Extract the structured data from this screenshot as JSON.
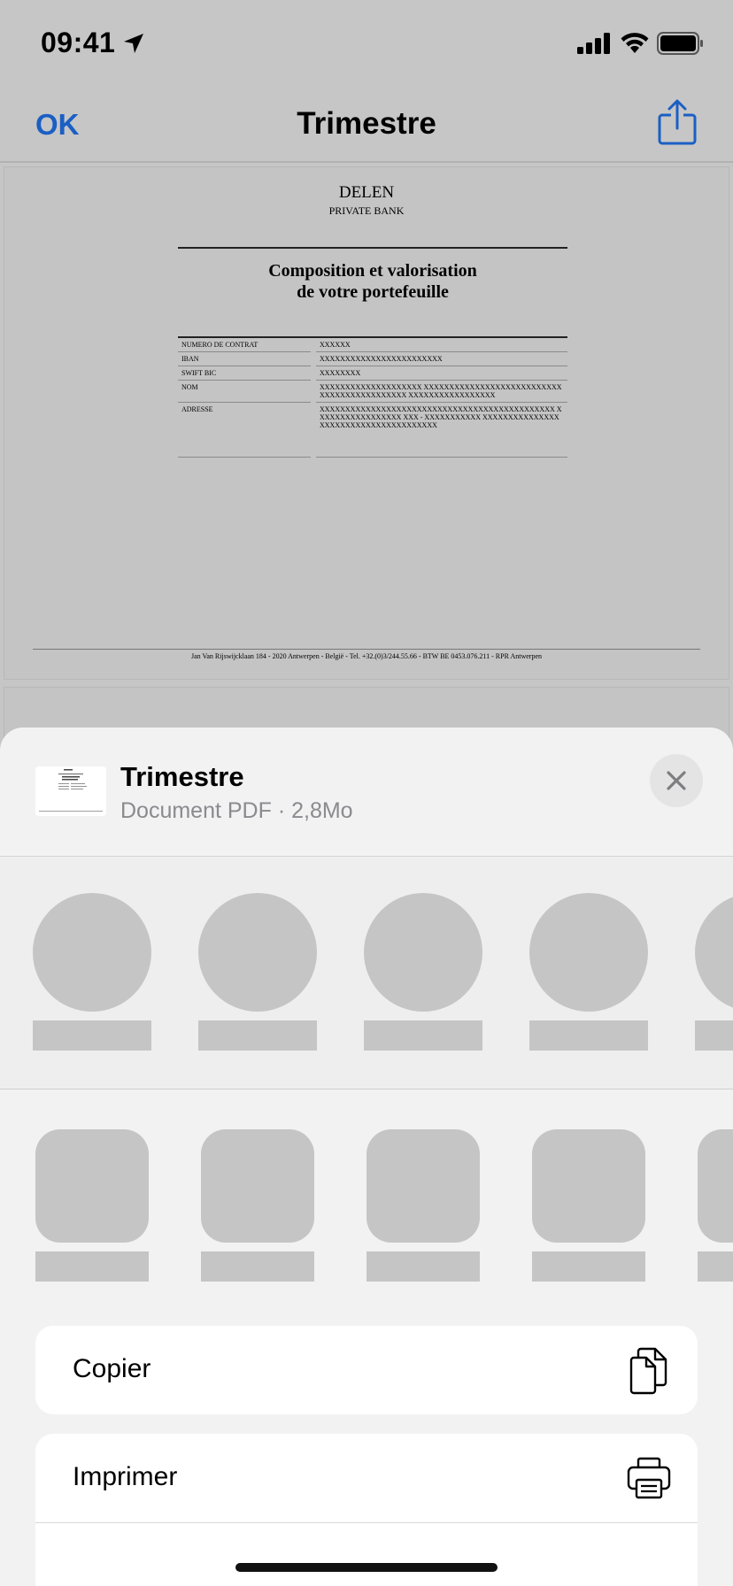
{
  "status_bar": {
    "time": "09:41"
  },
  "nav": {
    "ok_label": "OK",
    "title": "Trimestre"
  },
  "document": {
    "bank_name": "DELEN",
    "bank_subtitle": "PRIVATE BANK",
    "heading_line1": "Composition et valorisation",
    "heading_line2": "de votre portefeuille",
    "rows": [
      {
        "label": "NUMERO DE CONTRAT",
        "value": "XXXXXX"
      },
      {
        "label": "IBAN",
        "value": "XXXXXXXXXXXXXXXXXXXXXXXX"
      },
      {
        "label": "SWIFT BIC",
        "value": "XXXXXXXX"
      },
      {
        "label": "NOM",
        "value": "XXXXXXXXXXXXXXXXXXXX XXXXXXXXXXXXXXXXXXXXXXXXXXXXXXXXXXXXXXXXXXXX XXXXXXXXXXXXXXXXX"
      },
      {
        "label": "ADRESSE",
        "value": "XXXXXXXXXXXXXXXXXXXXXXXXXXXXXXXXXXXXXXXXXXXXXX XXXXXXXXXXXXXXXXX XXX - XXXXXXXXXXX XXXXXXXXXXXXXXXXXXXXXXXXXXXXXXXXXXXXXX"
      }
    ],
    "footer": "Jan Van Rijswijcklaan 184 - 2020 Antwerpen - België - Tel. +32.(0)3/244.55.66 - BTW BE 0453.076.211 - RPR Antwerpen"
  },
  "sheet": {
    "title": "Trimestre",
    "meta": "Document PDF · 2,8Mo",
    "actions": [
      {
        "label": "Copier",
        "icon": "copy-icon"
      },
      {
        "label": "Imprimer",
        "icon": "print-icon"
      }
    ]
  },
  "colors": {
    "accent": "#1b5fc4",
    "sheet_bg": "#f2f2f2",
    "placeholder": "#c4c5c4"
  }
}
